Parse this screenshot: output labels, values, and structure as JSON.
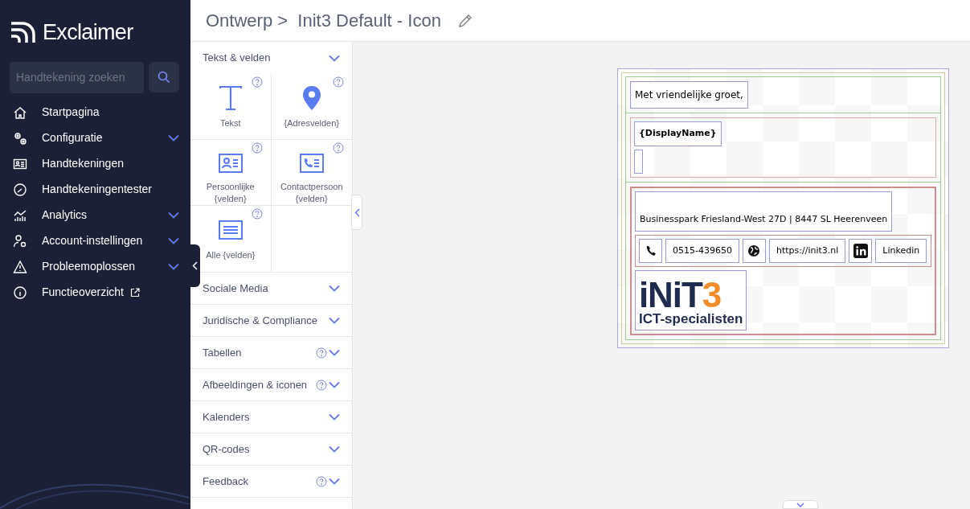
{
  "brand": "Exclaimer",
  "search": {
    "placeholder": "Handtekening zoeken"
  },
  "nav": [
    {
      "label": "Startpagina",
      "expandable": false,
      "external": false
    },
    {
      "label": "Configuratie",
      "expandable": true,
      "external": false
    },
    {
      "label": "Handtekeningen",
      "expandable": false,
      "external": false
    },
    {
      "label": "Handtekeningentester",
      "expandable": false,
      "external": false
    },
    {
      "label": "Analytics",
      "expandable": true,
      "external": false
    },
    {
      "label": "Account-instellingen",
      "expandable": true,
      "external": false
    },
    {
      "label": "Probleemoplossen",
      "expandable": true,
      "external": false
    },
    {
      "label": "Functieoverzicht",
      "expandable": false,
      "external": true
    }
  ],
  "breadcrumb": {
    "parent": "Ontwerp",
    "separator": ">",
    "current": "Init3 Default - Icon"
  },
  "palette": {
    "first_section": "Tekst & velden",
    "tiles": [
      {
        "label": "Tekst"
      },
      {
        "label": "{Adresvelden}"
      },
      {
        "label": "Persoonlijke {velden}"
      },
      {
        "label": "Contactpersoon {velden}"
      },
      {
        "label": "Alle {velden}"
      }
    ],
    "sections": [
      {
        "title": "Sociale Media",
        "help": false
      },
      {
        "title": "Juridische & Compliance",
        "help": false
      },
      {
        "title": "Tabellen",
        "help": true
      },
      {
        "title": "Afbeeldingen & iconen",
        "help": true
      },
      {
        "title": "Kalenders",
        "help": false
      },
      {
        "title": "QR-codes",
        "help": false
      },
      {
        "title": "Feedback",
        "help": true
      }
    ]
  },
  "signature": {
    "greeting": "Met vriendelijke groet,",
    "display_name": "{DisplayName}",
    "address": "Businesspark Friesland-West 27D | 8447 SL Heerenveen",
    "contacts": [
      {
        "kind": "icon"
      },
      {
        "kind": "text",
        "text": "0515-439650"
      },
      {
        "kind": "icon"
      },
      {
        "kind": "text",
        "text": "https://init3.nl"
      },
      {
        "kind": "icon"
      },
      {
        "kind": "text",
        "text": "Linkedin"
      }
    ],
    "logo": {
      "wordmark": "iNiT",
      "accent": "3",
      "tagline": "ICT-specialisten"
    }
  }
}
